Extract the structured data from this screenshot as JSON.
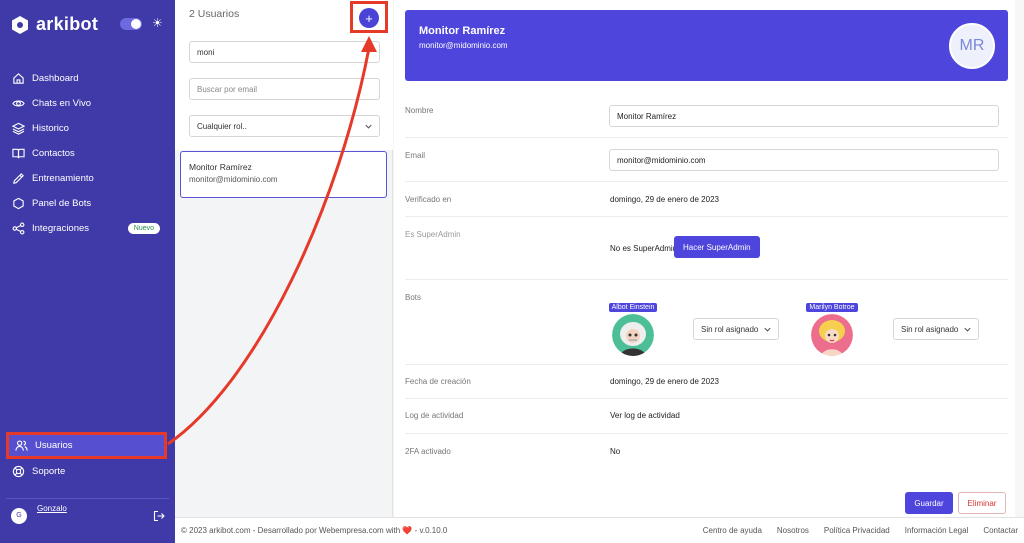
{
  "app": {
    "name": "arkibot"
  },
  "sidebar": {
    "items": [
      {
        "label": "Dashboard",
        "icon": "home-icon"
      },
      {
        "label": "Chats en Vivo",
        "icon": "eye-icon"
      },
      {
        "label": "Historico",
        "icon": "layers-icon"
      },
      {
        "label": "Contactos",
        "icon": "book-icon"
      },
      {
        "label": "Entrenamiento",
        "icon": "pencil-icon"
      },
      {
        "label": "Panel de Bots",
        "icon": "hexagon-icon"
      },
      {
        "label": "Integraciones",
        "icon": "share-icon",
        "badge": "Nuevo"
      }
    ],
    "bottom_items": [
      {
        "label": "Usuarios",
        "icon": "users-icon"
      },
      {
        "label": "Soporte",
        "icon": "lifebuoy-icon"
      }
    ],
    "user": {
      "initial": "G",
      "name": "Gonzalo"
    }
  },
  "list": {
    "title": "2 Usuarios",
    "add_symbol": "+",
    "search_value": "moni",
    "email_placeholder": "Buscar por email",
    "role_select": "Cualquier rol..",
    "users": [
      {
        "name": "Monitor Ramírez",
        "email": "monitor@midominio.com"
      }
    ]
  },
  "detail": {
    "header": {
      "name": "Monitor Ramírez",
      "email": "monitor@midominio.com",
      "initials": "MR"
    },
    "fields": {
      "nombre_label": "Nombre",
      "nombre_value": "Monitor Ramírez",
      "email_label": "Email",
      "email_value": "monitor@midominio.com",
      "verificado_label": "Verificado en",
      "verificado_value": "domingo, 29 de enero de 2023",
      "superadmin_label": "Es SuperAdmin",
      "superadmin_value": "No es SuperAdmin",
      "superadmin_button": "Hacer SuperAdmin",
      "bots_label": "Bots",
      "fecha_label": "Fecha de creación",
      "fecha_value": "domingo, 29 de enero de 2023",
      "log_label": "Log de actividad",
      "log_link": "Ver log de actividad",
      "twofa_label": "2FA activado",
      "twofa_value": "No"
    },
    "bots": [
      {
        "name": "Albot Einstein",
        "role": "Sin rol asignado"
      },
      {
        "name": "Marilyn Botroe",
        "role": "Sin rol asignado"
      }
    ],
    "save_button": "Guardar",
    "delete_button": "Eliminar"
  },
  "footer": {
    "copyright": "© 2023 arkibot.com - Desarrollado por Webempresa.com with",
    "heart": "❤️",
    "version": "- v.0.10.0",
    "links": [
      "Centro de ayuda",
      "Nosotros",
      "Política Privacidad",
      "Información Legal",
      "Contactar"
    ]
  },
  "colors": {
    "primary": "#4d45dc",
    "sidebar": "#3f3aa8",
    "highlight": "#e53a2a"
  }
}
